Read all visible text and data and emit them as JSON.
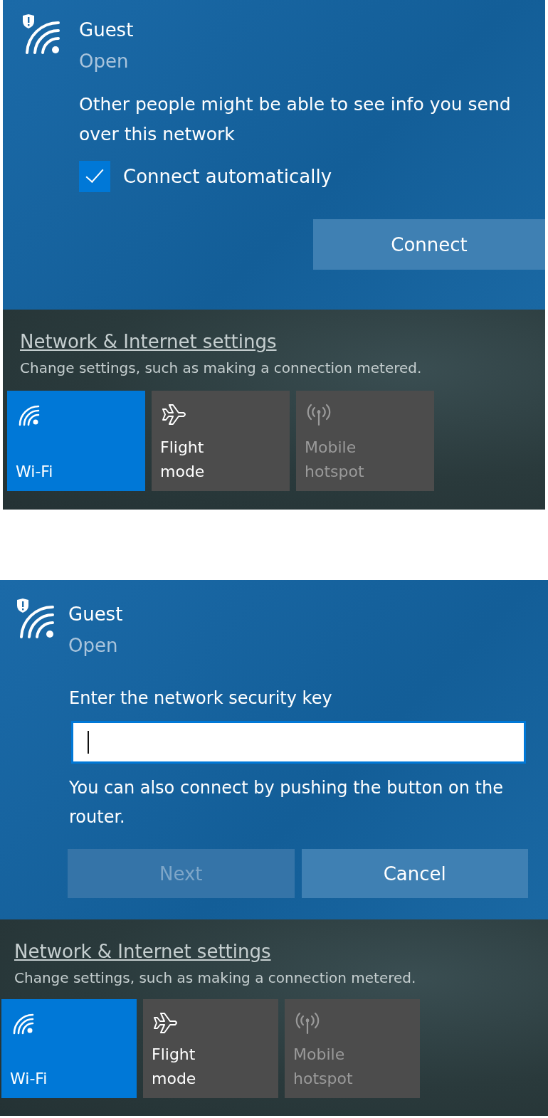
{
  "panels": [
    {
      "kind": "connect",
      "network": {
        "name": "Guest",
        "status": "Open"
      },
      "warning": "Other people might be able to see info you send over this network",
      "connect_automatically": {
        "label": "Connect automatically",
        "checked": true
      },
      "buttons": [
        {
          "label": "Connect",
          "disabled": false
        }
      ],
      "settings_link": "Network & Internet settings",
      "settings_description": "Change settings, such as making a connection metered.",
      "tiles": [
        {
          "kind": "wifi",
          "label": "Wi-Fi",
          "on": true,
          "disabled": false
        },
        {
          "kind": "airplane",
          "label": "Flight mode",
          "on": false,
          "disabled": false
        },
        {
          "kind": "hotspot",
          "label": "Mobile hotspot",
          "on": false,
          "disabled": true
        }
      ]
    },
    {
      "kind": "key",
      "network": {
        "name": "Guest",
        "status": "Open"
      },
      "prompt": "Enter the network security key",
      "hint": "You can also connect by pushing the button on the router.",
      "buttons": [
        {
          "label": "Next",
          "disabled": true
        },
        {
          "label": "Cancel",
          "disabled": false
        }
      ],
      "settings_link": "Network & Internet settings",
      "settings_description": "Change settings, such as making a connection metered.",
      "tiles": [
        {
          "kind": "wifi",
          "label": "Wi-Fi",
          "on": true,
          "disabled": false
        },
        {
          "kind": "airplane",
          "label": "Flight mode",
          "on": false,
          "disabled": false
        },
        {
          "kind": "hotspot",
          "label": "Mobile hotspot",
          "on": false,
          "disabled": true
        }
      ]
    }
  ]
}
